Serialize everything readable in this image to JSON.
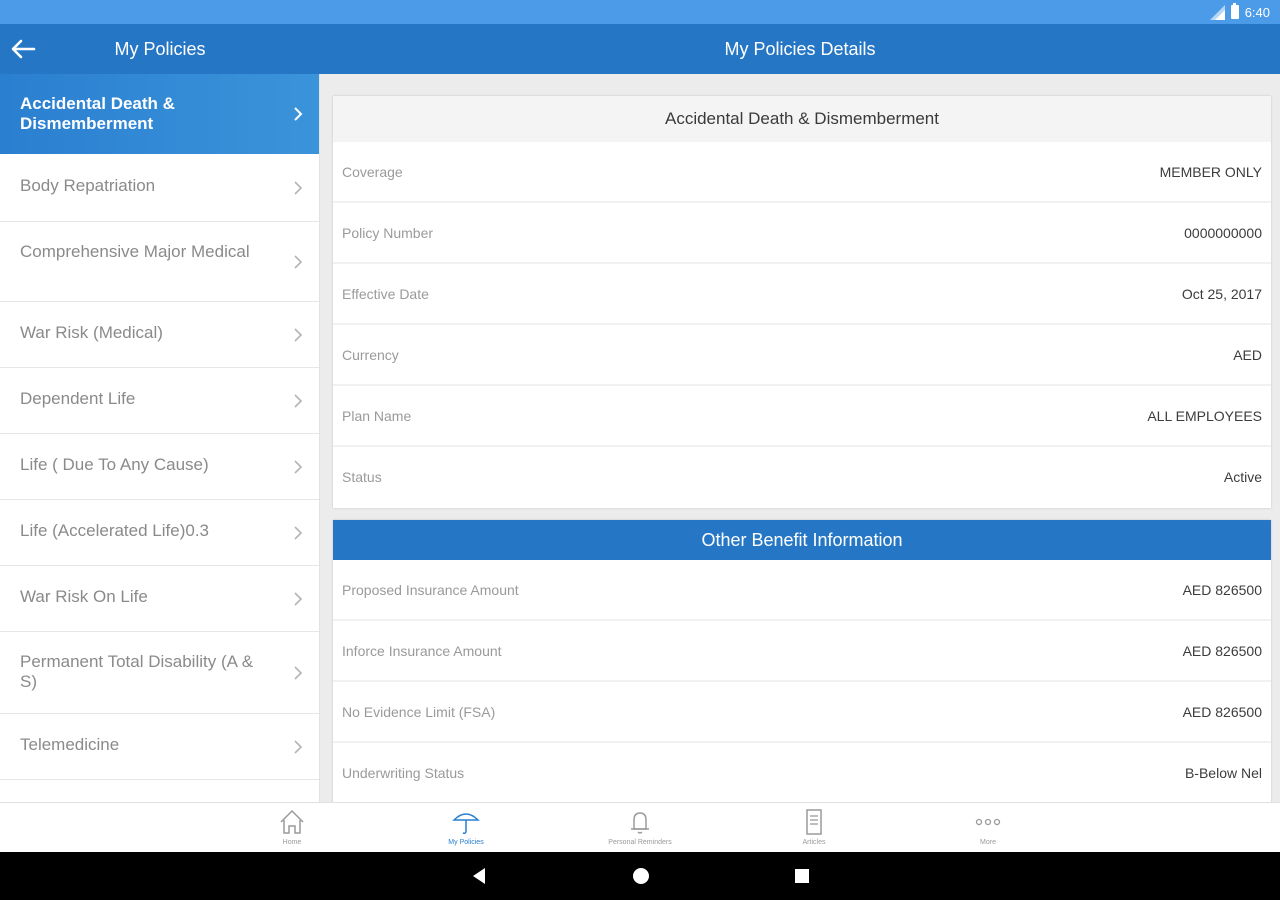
{
  "status_bar": {
    "time": "6:40"
  },
  "app_bar": {
    "left_title": "My Policies",
    "right_title": "My Policies Details"
  },
  "sidebar": {
    "items": [
      {
        "label": "Accidental Death & Dismemberment",
        "active": true
      },
      {
        "label": "Body Repatriation"
      },
      {
        "label": "Comprehensive Major Medical"
      },
      {
        "label": "War Risk (Medical)"
      },
      {
        "label": "Dependent Life"
      },
      {
        "label": "Life ( Due To Any Cause)"
      },
      {
        "label": "Life (Accelerated Life)0.3"
      },
      {
        "label": "War Risk On Life"
      },
      {
        "label": "Permanent Total Disability (A & S)"
      },
      {
        "label": "Telemedicine"
      }
    ]
  },
  "policy_card": {
    "title": "Accidental Death & Dismemberment",
    "rows": [
      {
        "key": "Coverage",
        "value": "MEMBER ONLY"
      },
      {
        "key": "Policy Number",
        "value": "0000000000"
      },
      {
        "key": "Effective Date",
        "value": "Oct 25, 2017"
      },
      {
        "key": "Currency",
        "value": "AED"
      },
      {
        "key": "Plan Name",
        "value": "ALL EMPLOYEES"
      },
      {
        "key": "Status",
        "value": "Active"
      }
    ]
  },
  "benefit_card": {
    "title": "Other Benefit Information",
    "rows": [
      {
        "key": "Proposed Insurance Amount",
        "value": "AED 826500"
      },
      {
        "key": "Inforce Insurance Amount",
        "value": "AED 826500"
      },
      {
        "key": "No Evidence Limit (FSA)",
        "value": "AED 826500"
      },
      {
        "key": "Underwriting Status",
        "value": "B-Below Nel"
      }
    ]
  },
  "bottom_nav": {
    "items": [
      {
        "label": "Home",
        "icon": "home-icon"
      },
      {
        "label": "My Policies",
        "icon": "umbrella-icon",
        "active": true
      },
      {
        "label": "Personal Reminders",
        "icon": "bell-icon"
      },
      {
        "label": "Articles",
        "icon": "document-icon"
      },
      {
        "label": "More",
        "icon": "more-dots-icon"
      }
    ]
  },
  "colors": {
    "status_bar": "#4c9be8",
    "app_bar": "#2577c6",
    "active_item": "#3b94da",
    "content_bg": "#ececec"
  }
}
